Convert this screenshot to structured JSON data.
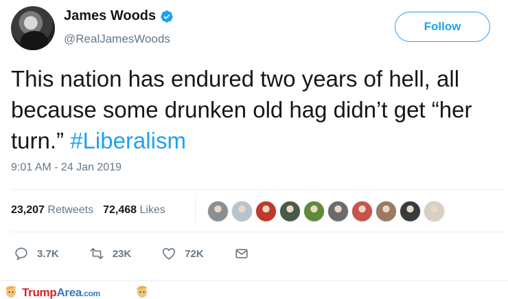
{
  "user": {
    "display_name": "James Woods",
    "handle": "@RealJamesWoods",
    "verified": true,
    "avatar_icon": "profile-photo"
  },
  "follow_button": {
    "label": "Follow"
  },
  "tweet": {
    "text_plain": "This nation has endured two years of hell, all because some drunken old hag didn’t get “her turn.” ",
    "hashtag": "#Liberalism",
    "timestamp": "9:01 AM - 24 Jan 2019"
  },
  "stats": {
    "retweets_count": "23,207",
    "retweets_label": "Retweets",
    "likes_count": "72,468",
    "likes_label": "Likes"
  },
  "likers": [
    "#8a8f94",
    "#b8c4cd",
    "#c0392b",
    "#4a5a4a",
    "#5e8a3a",
    "#6b6b6b",
    "#c8534a",
    "#9a7a62",
    "#3a3a3a",
    "#d8d0c0"
  ],
  "actions": {
    "reply_count": "3.7K",
    "retweet_count": "23K",
    "like_count": "72K"
  },
  "footer": {
    "brand_part1": "Trump",
    "brand_part2": "Area",
    "brand_suffix": ".com"
  },
  "colors": {
    "accent": "#1da1f2",
    "muted": "#657786",
    "text": "#14171a"
  }
}
